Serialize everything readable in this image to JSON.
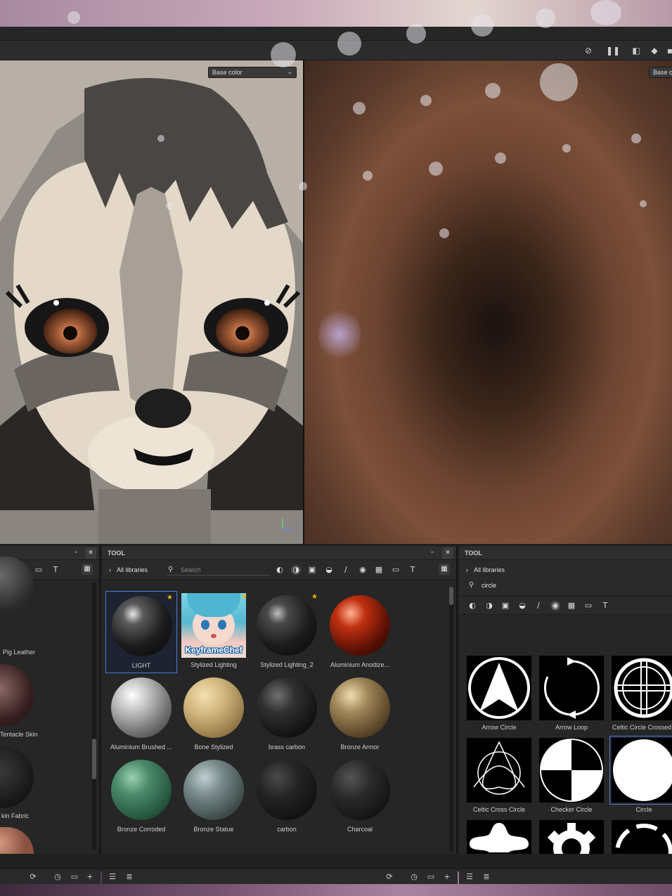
{
  "viewports": {
    "left_channel": "Base color",
    "right_channel": "Base c"
  },
  "panels": {
    "left_partial": {
      "items": [
        {
          "label": "Pig Leather"
        },
        {
          "label": "Tentacle Skin"
        },
        {
          "label": "kin Fabric"
        }
      ]
    },
    "materials": {
      "title": "TOOL",
      "library": "All libraries",
      "search_placeholder": "Search",
      "items": [
        {
          "label": "LIGHT",
          "starred": true,
          "selected": true,
          "color": "#2a2a2a"
        },
        {
          "label": "Stylized Lighting",
          "starred": true,
          "color": "#7fd4e6",
          "art_text": "KeyframeChef"
        },
        {
          "label": "Stylized Lighting_2",
          "starred": true,
          "color": "#2a2a2a"
        },
        {
          "label": "Aluminium Anodize...",
          "starred": false,
          "color": "#b32a10"
        },
        {
          "label": "Aluminium Brushed ...",
          "starred": false,
          "color": "#b4b4b4"
        },
        {
          "label": "Bone Stylized",
          "starred": false,
          "color": "#cdb27a"
        },
        {
          "label": "brass carbon",
          "starred": false,
          "color": "#262626"
        },
        {
          "label": "Bronze Armor",
          "starred": false,
          "color": "#8a7350"
        },
        {
          "label": "Bronze Corroded",
          "starred": false,
          "color": "#3f7a5e"
        },
        {
          "label": "Bronze Statue",
          "starred": false,
          "color": "#6f8282"
        },
        {
          "label": "carbon",
          "starred": false,
          "color": "#1f1f1f"
        },
        {
          "label": "Charcoal",
          "starred": false,
          "color": "#262626"
        }
      ]
    },
    "alphas": {
      "title": "TOOL",
      "library": "All libraries",
      "search_value": "circle",
      "items": [
        {
          "label": "Arrow Circle"
        },
        {
          "label": "Arrow Loop"
        },
        {
          "label": "Celtic Circle Crossed"
        },
        {
          "label": "Celtic Cross Circle"
        },
        {
          "label": "Checker Circle"
        },
        {
          "label": "Circle"
        },
        {
          "label": ""
        },
        {
          "label": ""
        },
        {
          "label": ""
        }
      ]
    }
  },
  "icons": {
    "close": "×",
    "star": "★",
    "chevron_right": "›",
    "chevron_down": "⌄",
    "search": "⚲",
    "text_tool": "T",
    "add": "+"
  },
  "colors": {
    "accent": "#4b7ad6",
    "star": "#f0b400",
    "panel_bg": "#262626"
  }
}
